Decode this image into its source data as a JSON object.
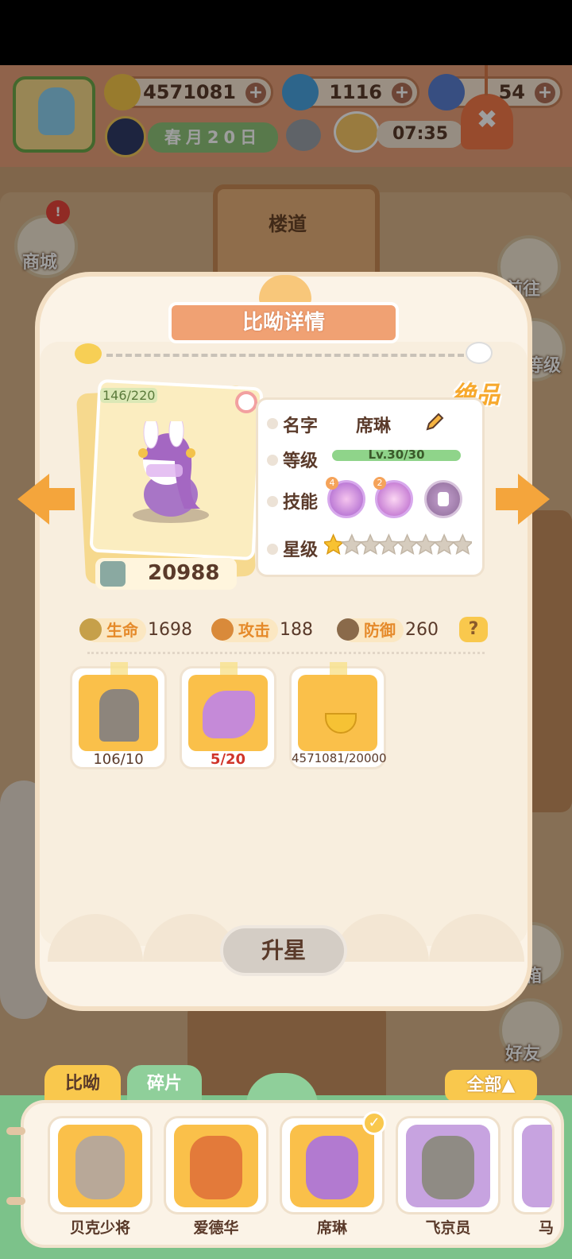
{
  "top_bar": {
    "resources": [
      {
        "name": "banana-icon",
        "value": "4571081"
      },
      {
        "name": "flame-icon",
        "value": "1116"
      },
      {
        "name": "fish-icon",
        "value": "54"
      }
    ],
    "date": "春月20日",
    "time": "07:35"
  },
  "background": {
    "corridor_sign": "楼道",
    "side_buttons": {
      "shop": "商城",
      "goto": "前往",
      "level": "等级",
      "mail": "邮箱",
      "friends": "好友"
    }
  },
  "panel": {
    "title": "比呦详情",
    "grade": "绝品",
    "card": {
      "hp_counter": "146/220",
      "power": "20988"
    },
    "info": {
      "name_label": "名字",
      "name_value": "席琳",
      "level_label": "等级",
      "level_value": "Lv.30/30",
      "level_progress": 1.0,
      "skill_label": "技能",
      "skills": [
        {
          "icon": "swirl-skill-icon",
          "badge": "4"
        },
        {
          "icon": "heart-skill-icon",
          "badge": "2"
        },
        {
          "icon": "locked-skill-icon",
          "badge": ""
        }
      ],
      "star_label": "星级",
      "stars_filled": 1,
      "stars_total": 8
    },
    "stats": {
      "hp_label": "生命",
      "hp_value": "1698",
      "atk_label": "攻击",
      "atk_value": "188",
      "def_label": "防御",
      "def_value": "260",
      "help": "?"
    },
    "materials": [
      {
        "icon": "statue-icon",
        "count": "106/10"
      },
      {
        "icon": "shard-icon",
        "count": "5/20"
      },
      {
        "icon": "banana-icon",
        "count": "4571081/20000"
      }
    ],
    "upgrade_button": "升星"
  },
  "bottom": {
    "tab_pets": "比呦",
    "tab_shards": "碎片",
    "filter": "全部▲",
    "heroes": [
      {
        "name": "贝克少将"
      },
      {
        "name": "爱德华"
      },
      {
        "name": "席琳",
        "selected": true
      },
      {
        "name": "飞京员"
      },
      {
        "name": "马"
      }
    ]
  },
  "colors": {
    "accent_orange": "#f4a53c",
    "panel_bg": "#fbf3e7",
    "card_yellow": "#fac04a",
    "level_green": "#8fd48a"
  }
}
